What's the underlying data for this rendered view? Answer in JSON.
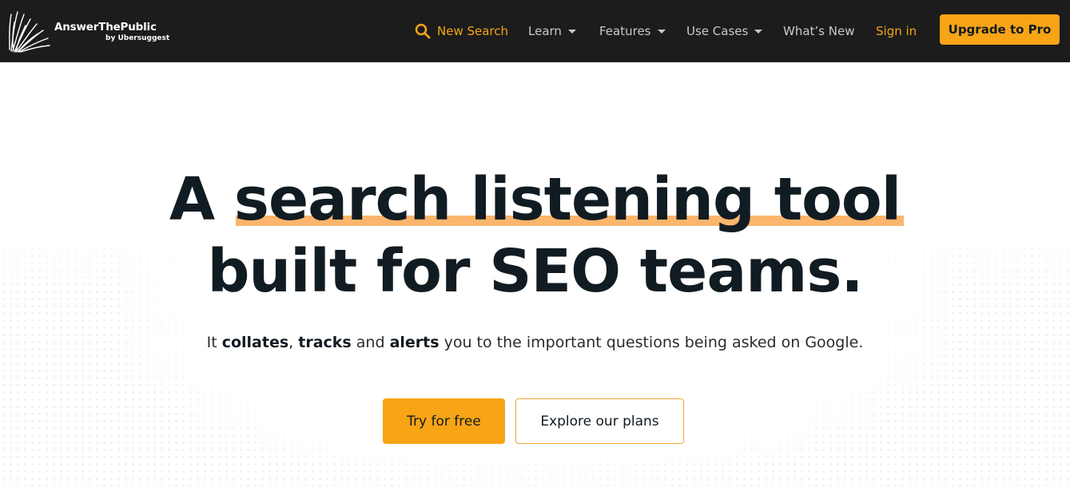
{
  "brand": {
    "name": "AnswerThePublic",
    "sub": "by Ubersuggest",
    "logo_icon": "burst-lines-icon"
  },
  "nav": {
    "new_search": "New Search",
    "learn": "Learn",
    "features": "Features",
    "use_cases": "Use Cases",
    "whats_new": "What’s New",
    "sign_in": "Sign in",
    "upgrade": "Upgrade to Pro"
  },
  "hero": {
    "line1_prefix": "A",
    "line1_highlight": "search listening tool",
    "line2": "built for SEO teams.",
    "subtitle_parts": {
      "p1": "It ",
      "b1": "collates",
      "p2": ", ",
      "b2": "tracks",
      "p3": " and ",
      "b3": "alerts",
      "p4": " you to the important questions being asked on Google."
    },
    "cta_primary": "Try for free",
    "cta_secondary": "Explore our plans"
  },
  "colors": {
    "accent": "#f7a416",
    "header_bg": "#1c1c1c",
    "highlight": "#fbb56c",
    "text": "#111b22"
  }
}
